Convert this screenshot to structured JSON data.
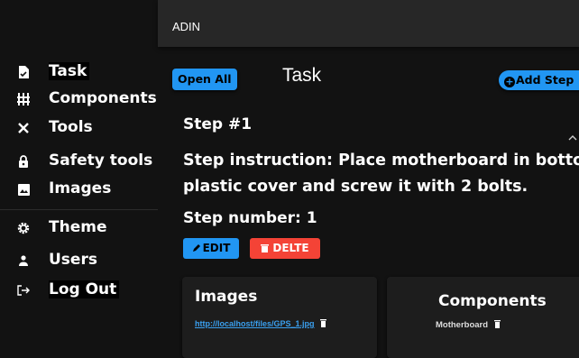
{
  "app": {
    "title": "ADIN"
  },
  "sidebar": {
    "items": [
      {
        "label": "Task",
        "icon": "task-icon"
      },
      {
        "label": "Components",
        "icon": "components-icon"
      },
      {
        "label": "Tools",
        "icon": "tools-icon"
      },
      {
        "label": "Safety tools",
        "icon": "lock-icon"
      },
      {
        "label": "Images",
        "icon": "image-icon"
      },
      {
        "label": "Theme",
        "icon": "gear-icon"
      },
      {
        "label": "Users",
        "icon": "user-icon"
      },
      {
        "label": "Log Out",
        "icon": "logout-icon"
      }
    ]
  },
  "main": {
    "open_all_label": "Open All",
    "page_title": "Task",
    "add_step_label": "Add Step",
    "step": {
      "heading": "Step #1",
      "instruction_line1": "Step instruction: Place motherboard in bottom",
      "instruction_line2": "plastic cover and screw it with 2 bolts.",
      "number_label": "Step number: 1",
      "edit_label": "EDIT",
      "delete_label": "DELTE",
      "images_title": "Images",
      "image_link": "http://localhost/files/GPS_1.jpg",
      "components_title": "Components",
      "component_name": "Motherboard"
    }
  },
  "colors": {
    "primary": "#2196f3",
    "danger": "#f44336",
    "background": "#121212",
    "appbar": "#272727"
  }
}
